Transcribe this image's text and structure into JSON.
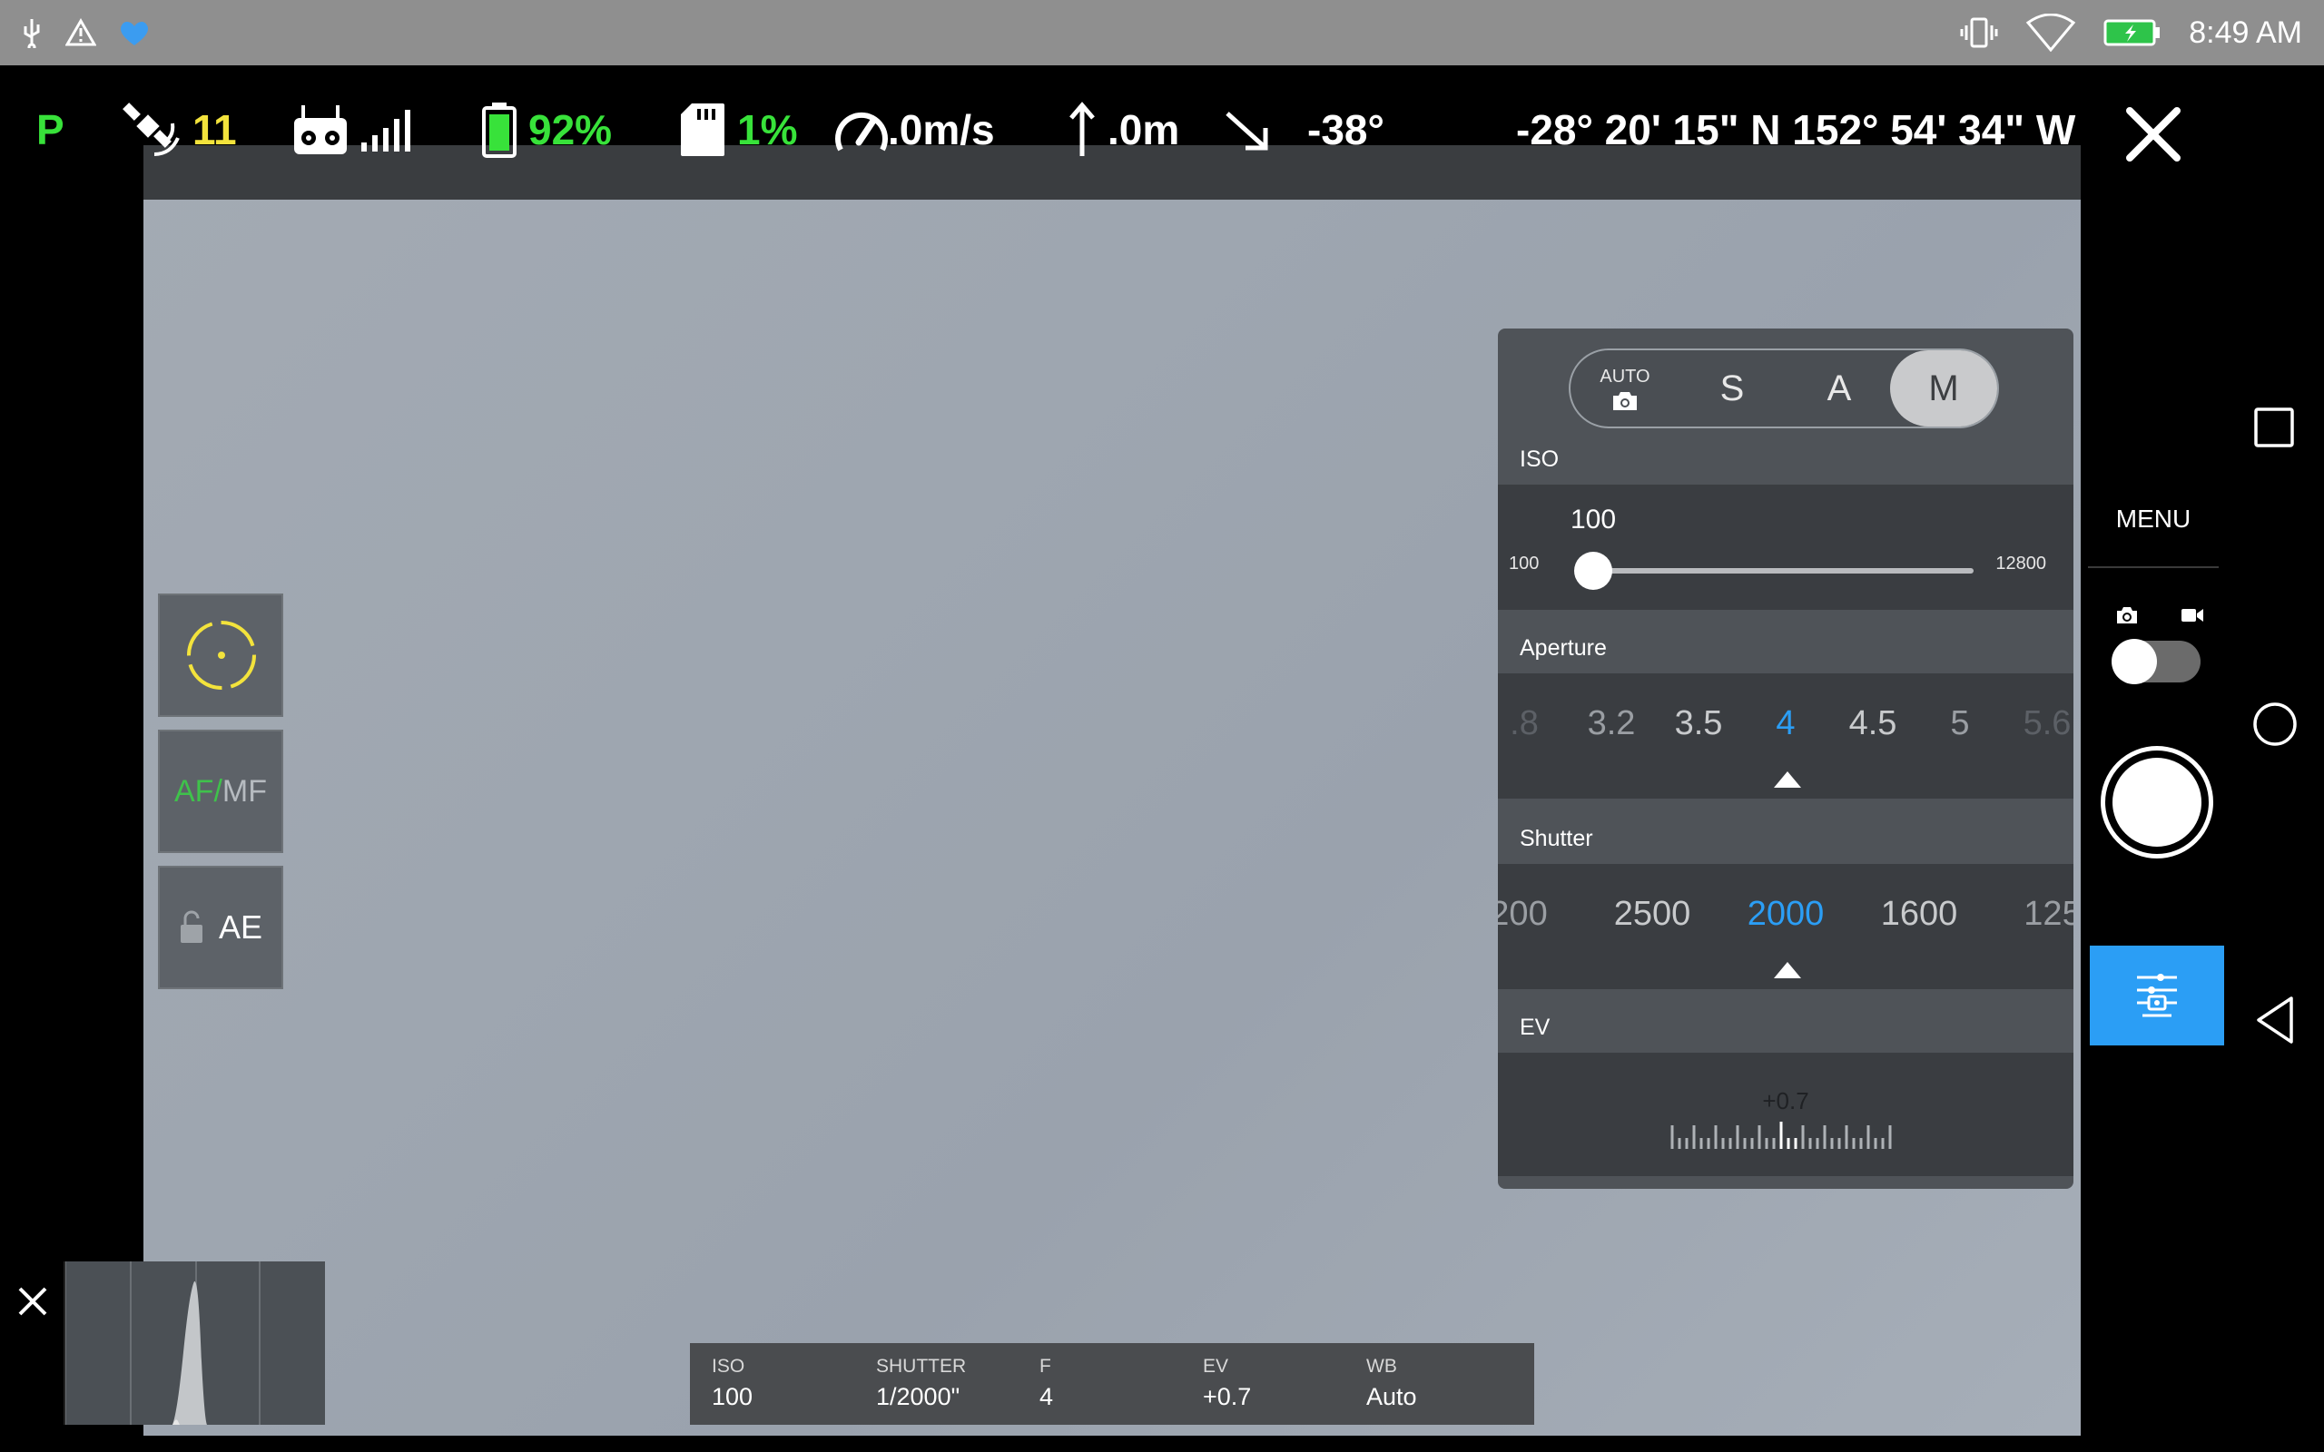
{
  "statusbar": {
    "left_icons": [
      "usb-icon",
      "warning-icon",
      "heart-app-icon"
    ],
    "time": "8:49 AM",
    "right_icons": [
      "vibrate-icon",
      "wifi-icon",
      "battery-charging-icon"
    ]
  },
  "telemetry": {
    "flight_mode": "P",
    "satellites": "11",
    "battery": "92%",
    "sd_usage": "1%",
    "speed": ".0m/s",
    "altitude": ".0m",
    "gimbal_pitch": "-38°",
    "gps": "-28° 20' 15\" N 152° 54' 34\" W"
  },
  "right_panel": {
    "menu_label": "MENU",
    "close_icon": "close-icon",
    "photo_icon": "camera-icon",
    "video_icon": "video-icon"
  },
  "left_tools": {
    "af_label": "AF/",
    "mf_label": "MF",
    "ae_label": "AE"
  },
  "camera_settings": {
    "modes": {
      "auto_label": "AUTO",
      "s": "S",
      "a": "A",
      "m": "M",
      "selected": "M"
    },
    "iso": {
      "label": "ISO",
      "value": "100",
      "min": "100",
      "max": "12800",
      "slider_fraction": 0
    },
    "aperture": {
      "label": "Aperture",
      "values": [
        ".8",
        "3.2",
        "3.5",
        "4",
        "4.5",
        "5",
        "5.6"
      ],
      "selected": "4"
    },
    "shutter": {
      "label": "Shutter",
      "values": [
        "200",
        "2500",
        "2000",
        "1600",
        "125"
      ],
      "selected": "2000"
    },
    "ev": {
      "label": "EV",
      "value": "+0.7"
    }
  },
  "info_bar": {
    "iso_key": "ISO",
    "iso_val": "100",
    "shutter_key": "SHUTTER",
    "shutter_val": "1/2000\"",
    "f_key": "F",
    "f_val": "4",
    "ev_key": "EV",
    "ev_val": "+0.7",
    "wb_key": "WB",
    "wb_val": "Auto"
  },
  "colors": {
    "accent_blue": "#2b9ef5",
    "telemetry_green": "#38e23a",
    "telemetry_yellow": "#f3e33c"
  }
}
